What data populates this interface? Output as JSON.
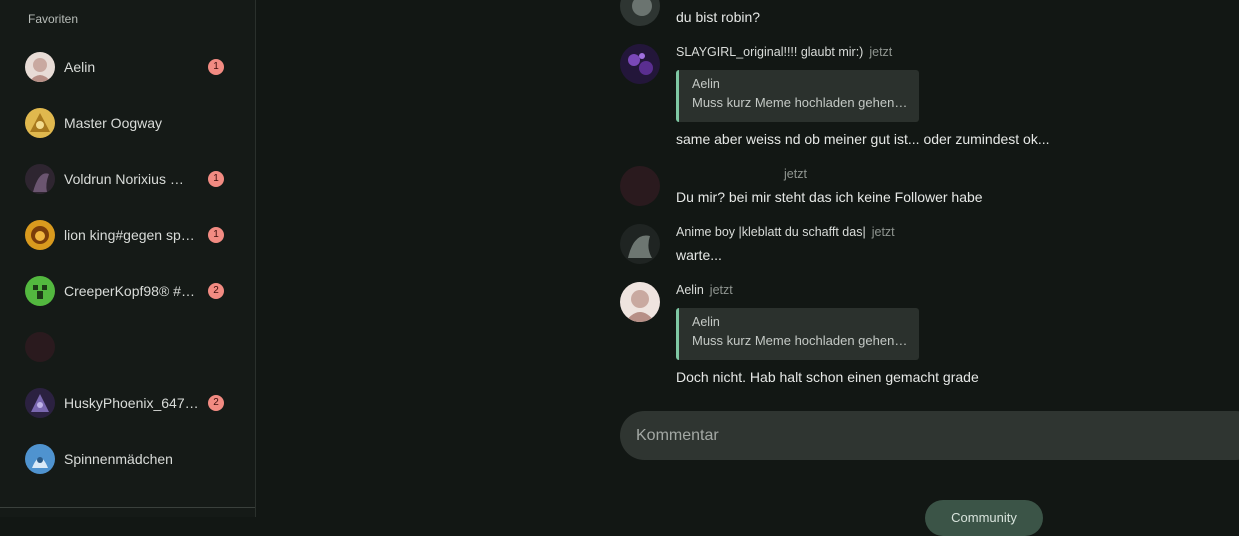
{
  "sidebar": {
    "section_title": "Favoriten",
    "items": [
      {
        "label": "Aelin",
        "badge": "1",
        "avatar_color": "#d9c7c0"
      },
      {
        "label": "Master Oogway",
        "badge": "",
        "avatar_color": "#c9a54a"
      },
      {
        "label": "Voldrun Norixius 🕷️🏹",
        "badge": "1",
        "avatar_color": "#4a3b45"
      },
      {
        "label": "lion king#gegen sp…",
        "badge": "1",
        "avatar_color": "#c98a1e"
      },
      {
        "label": "CreeperKopf98® #…",
        "badge": "2",
        "avatar_color": "#4caf3a"
      },
      {
        "label": "",
        "badge": "",
        "avatar_color": "#2a1a1e"
      },
      {
        "label": "HuskyPhoenix_647…",
        "badge": "2",
        "avatar_color": "#5a4a7a"
      },
      {
        "label": "Spinnenmädchen",
        "badge": "",
        "avatar_color": "#6fa9d9"
      }
    ]
  },
  "messages": [
    {
      "author": "",
      "time": "",
      "text": "du bist robin?",
      "avatar_color": "#3a3f3c"
    },
    {
      "author": "SLAYGIRL_original!!!! glaubt mir:)",
      "time": "jetzt",
      "quote_author": "Aelin",
      "quote_text": "Muss kurz Meme hochladen gehen…",
      "text": "same aber weiss nd ob meiner gut ist... oder zumindest ok...",
      "avatar_color": "#3a2650"
    },
    {
      "author": "",
      "time": "jetzt",
      "text": "Du mir? bei mir steht das ich keine Follower habe",
      "avatar_color": "#2a1a1e"
    },
    {
      "author": "Anime boy |kleblatt du schafft das|",
      "time": "jetzt",
      "text": "warte...",
      "avatar_color": "#2e3532"
    },
    {
      "author": "Aelin",
      "time": "jetzt",
      "quote_author": "Aelin",
      "quote_text": "Muss kurz Meme hochladen gehen…",
      "text": "Doch nicht. Hab halt schon einen gemacht grade",
      "avatar_color": "#d9c7c0"
    }
  ],
  "comment": {
    "placeholder": "Kommentar"
  },
  "community_button": "Community"
}
